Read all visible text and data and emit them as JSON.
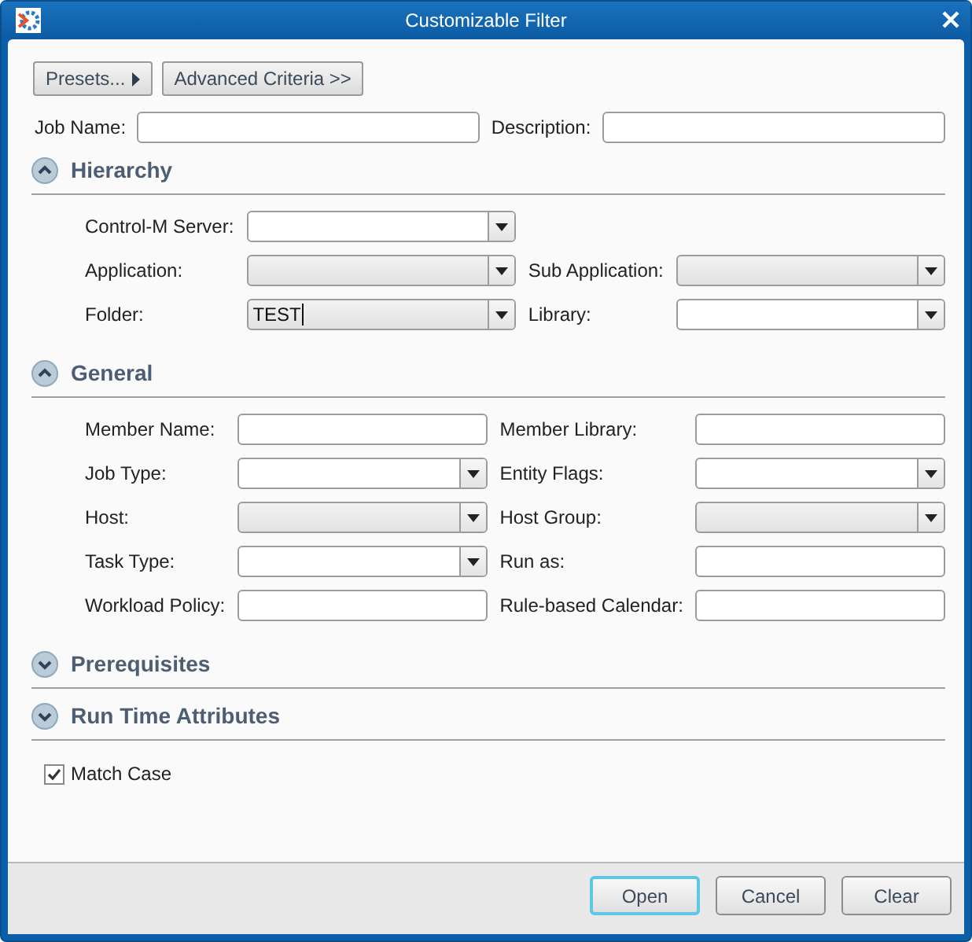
{
  "window": {
    "title": "Customizable Filter"
  },
  "toolbar": [
    {
      "label": "Presets...",
      "kind": "menu"
    },
    {
      "label": "Advanced Criteria >>",
      "kind": "plain"
    }
  ],
  "top_fields": [
    {
      "label": "Job Name:"
    },
    {
      "label": "Description:"
    }
  ],
  "sections": [
    {
      "title": "Hierarchy",
      "expanded": true,
      "rows": [
        [
          {
            "label": "Control-M Server:",
            "kind": "combo",
            "disabled": false,
            "focused": false
          },
          null
        ],
        [
          {
            "label": "Application:",
            "kind": "combo",
            "disabled": true,
            "focused": false
          },
          {
            "label": "Sub Application:",
            "kind": "combo",
            "disabled": true,
            "focused": false
          }
        ],
        [
          {
            "label": "Folder:",
            "kind": "combo",
            "value": "TEST",
            "disabled": false,
            "focused": true
          },
          {
            "label": "Library:",
            "kind": "combo",
            "disabled": false,
            "focused": false
          }
        ]
      ]
    },
    {
      "title": "General",
      "expanded": true,
      "rows": [
        [
          {
            "label": "Member Name:",
            "kind": "text",
            "disabled": false,
            "focused": false
          },
          {
            "label": "Member Library:",
            "kind": "text",
            "disabled": false,
            "focused": false
          }
        ],
        [
          {
            "label": "Job Type:",
            "kind": "combo",
            "disabled": false,
            "focused": false
          },
          {
            "label": "Entity Flags:",
            "kind": "combo",
            "disabled": false,
            "focused": false
          }
        ],
        [
          {
            "label": "Host:",
            "kind": "combo",
            "disabled": true,
            "focused": false
          },
          {
            "label": "Host Group:",
            "kind": "combo",
            "disabled": true,
            "focused": false
          }
        ],
        [
          {
            "label": "Task Type:",
            "kind": "combo",
            "disabled": false,
            "focused": false
          },
          {
            "label": "Run as:",
            "kind": "text",
            "disabled": false,
            "focused": false
          }
        ],
        [
          {
            "label": "Workload Policy:",
            "kind": "text",
            "disabled": false,
            "focused": false
          },
          {
            "label": "Rule-based Calendar:",
            "kind": "text",
            "disabled": false,
            "focused": false
          }
        ]
      ]
    },
    {
      "title": "Prerequisites",
      "expanded": false
    },
    {
      "title": "Run Time Attributes",
      "expanded": false
    }
  ],
  "match_case": {
    "label": "Match Case",
    "checked": true
  },
  "buttons": [
    {
      "label": "Open",
      "default": true
    },
    {
      "label": "Cancel",
      "default": false
    },
    {
      "label": "Clear",
      "default": false
    }
  ]
}
